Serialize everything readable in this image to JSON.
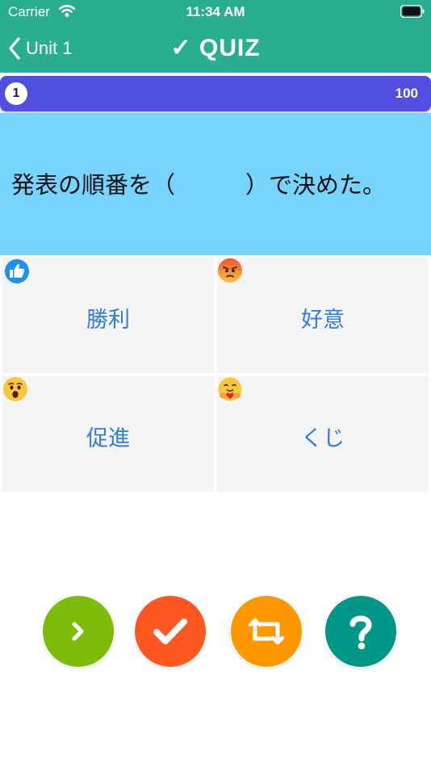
{
  "status_bar": {
    "carrier": "Carrier",
    "time": "11:34 AM"
  },
  "nav": {
    "back_label": "Unit 1",
    "title": "✓ QUIZ"
  },
  "progress": {
    "current": "1",
    "total": "100"
  },
  "question": {
    "text": "発表の順番を（　　　）で決めた。"
  },
  "answers": [
    {
      "label": "勝利",
      "reaction": "thumbs-up-icon"
    },
    {
      "label": "好意",
      "reaction": "angry-face-icon"
    },
    {
      "label": "促進",
      "reaction": "surprised-face-icon"
    },
    {
      "label": "くじ",
      "reaction": "hugging-face-icon"
    }
  ],
  "actions": [
    {
      "name": "next",
      "icon": "chevron-right-icon",
      "color": "#7dbd0a"
    },
    {
      "name": "check",
      "icon": "checkmark-icon",
      "color": "#ff5722"
    },
    {
      "name": "repeat",
      "icon": "repeat-icon",
      "color": "#ff9800"
    },
    {
      "name": "help",
      "icon": "question-icon",
      "color": "#009688"
    }
  ],
  "colors": {
    "nav": "#2aae92",
    "progress": "#504fe0",
    "question_bg": "#76d4fd",
    "tile_bg": "#f4f4f4",
    "answer_text": "#2f7dde"
  }
}
